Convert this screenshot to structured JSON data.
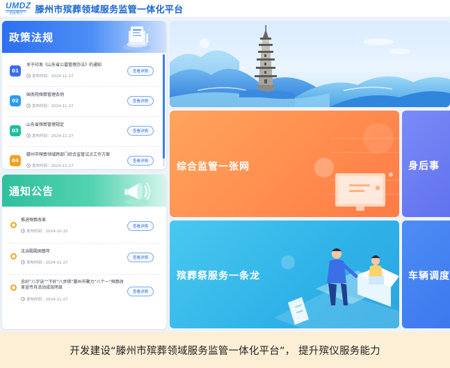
{
  "header": {
    "logo_mark": "UMDZ",
    "logo_sub": "一全民电子一",
    "title": "滕州市殡葬领域服务监管一体化平台"
  },
  "policy": {
    "title": "政策法规",
    "items": [
      {
        "num": "01",
        "title": "关于印发《山东省公墓管理办法》的通知",
        "date": "发布时间：2024-11-27",
        "button": "查看详情"
      },
      {
        "num": "02",
        "title": "国务院殡葬管理条例",
        "date": "发布时间：2024-11-27",
        "button": "查看详情"
      },
      {
        "num": "03",
        "title": "山东省殡葬管理规定",
        "date": "发布时间：2024-11-27",
        "button": "查看详情"
      },
      {
        "num": "04",
        "title": "滕州市殡葬领域跨部门综合监管试点工作方案",
        "date": "发布时间：2024-11-27",
        "button": "查看详情"
      }
    ]
  },
  "notice": {
    "title": "通知公告",
    "items": [
      {
        "title": "推进殡葬改革",
        "date": "发布时间：2024-10-15",
        "button": "查看详情"
      },
      {
        "title": "法治殿殿国基年",
        "date": "发布时间：2024-11-27",
        "button": "查看详情"
      },
      {
        "title": "念好“八字诀”“下好”八步棋”滕州市聚力“八个一”殡葬改革宣传月活动成效明显",
        "date": "发布时间：2024-11-27",
        "button": "查看详情"
      }
    ]
  },
  "tiles": {
    "orange": "综合监管一张网",
    "purple": "身后事",
    "cyan": "殡葬祭服务一条龙",
    "blue": "车辆调度"
  },
  "caption": "开发建设“滕州市殡葬领域服务监管一体化平台”， 提升殡仪服务能力",
  "colors": {
    "primary": "#2c6ff0",
    "teal": "#2fbf9c",
    "orange_tile": "#ff8d4f",
    "cyan_tile": "#2fb2e8",
    "caption_bg": "#fcefd6"
  }
}
